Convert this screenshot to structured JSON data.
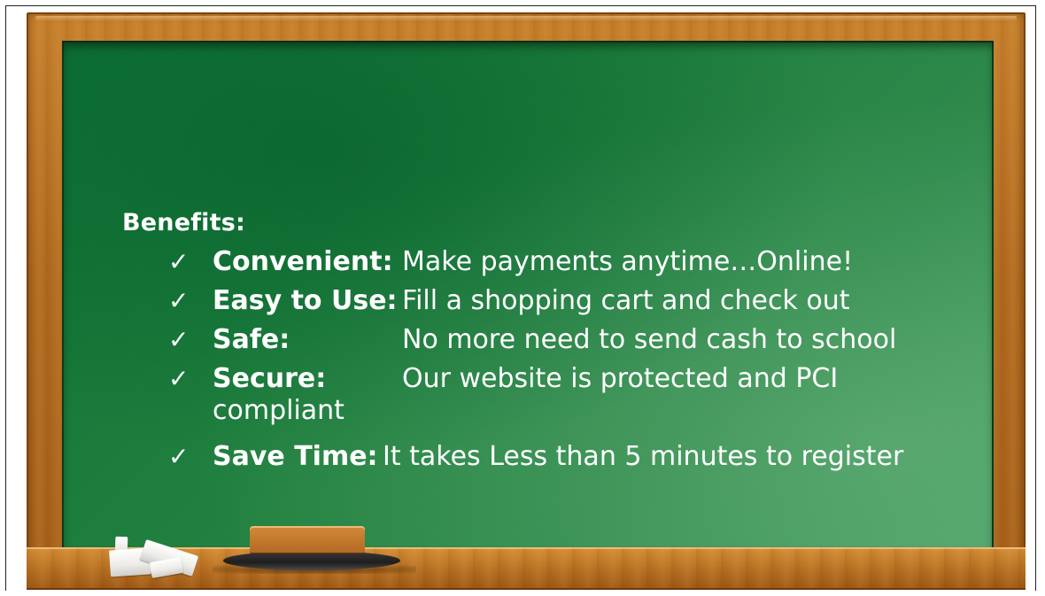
{
  "heading": "Benefits:",
  "check_icon": "checkmark-icon",
  "items": [
    {
      "term": "Convenient:",
      "description": "Make payments anytime…Online!"
    },
    {
      "term": "Easy to Use:",
      "description": "Fill a shopping cart and check out"
    },
    {
      "term": "Safe:",
      "description": "No more need to send cash to school"
    },
    {
      "term": "Secure:",
      "description": "Our website is protected and PCI",
      "description_wrap": "compliant"
    },
    {
      "term": "Save Time:",
      "description": "It takes Less than 5 minutes to register"
    }
  ],
  "colors": {
    "board_green": "#1f7f3e",
    "frame_wood": "#b06a1f",
    "chalk_text": "#ffffff"
  }
}
